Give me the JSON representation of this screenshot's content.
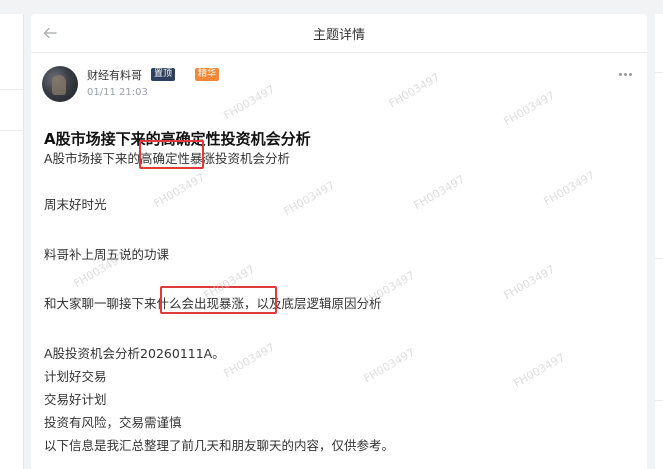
{
  "header": {
    "title": "主题详情",
    "back_icon": "arrow-left-icon"
  },
  "author": {
    "name": "财经有料哥",
    "badges": {
      "pin": "置顶",
      "featured": "精华"
    },
    "time": "01/11 21:03"
  },
  "post": {
    "title": "A股市场接下来的高确定性投资机会分析",
    "lines": [
      "A股市场接下来的高确定性暴涨投资机会分析",
      "周末好时光",
      "料哥补上周五说的功课",
      "和大家聊一聊接下来什么会出现暴涨，以及底层逻辑原因分析",
      "A股投资机会分析20260111A。",
      "计划好交易",
      "交易好计划",
      "投资有风险，交易需谨慎",
      "以下信息是我汇总整理了前几天和朋友聊天的内容，仅供参考。"
    ]
  },
  "watermark": "FH003497",
  "colors": {
    "highlight": "#e03a3a",
    "pin_badge": "#2f3f5f",
    "featured_badge": "#f0883a"
  }
}
